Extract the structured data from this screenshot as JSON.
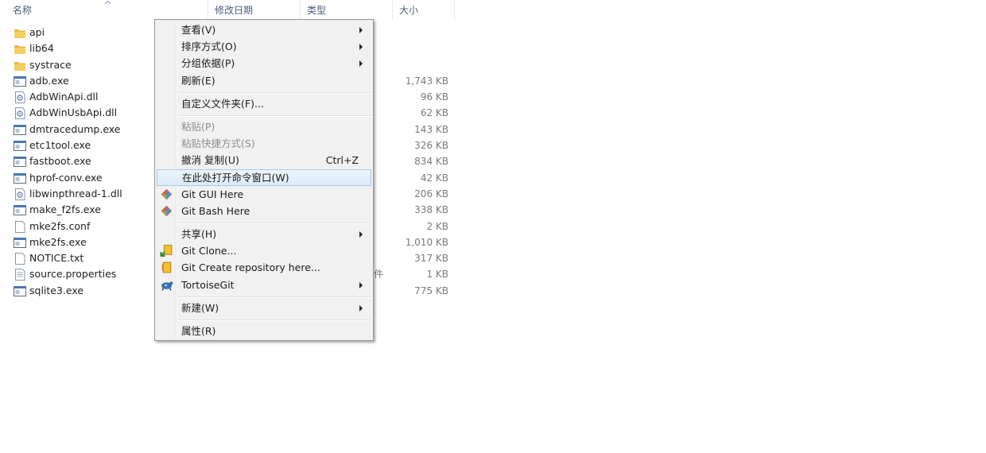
{
  "columns": {
    "name": "名称",
    "date": "修改日期",
    "type": "类型",
    "size": "大小"
  },
  "files": [
    {
      "name": "api",
      "icon": "folder-icon",
      "size": ""
    },
    {
      "name": "lib64",
      "icon": "folder-icon",
      "size": ""
    },
    {
      "name": "systrace",
      "icon": "folder-icon",
      "size": ""
    },
    {
      "name": "adb.exe",
      "icon": "exe-icon",
      "size": "1,743 KB"
    },
    {
      "name": "AdbWinApi.dll",
      "icon": "dll-icon",
      "size": "96 KB"
    },
    {
      "name": "AdbWinUsbApi.dll",
      "icon": "dll-icon",
      "size": "62 KB"
    },
    {
      "name": "dmtracedump.exe",
      "icon": "exe-icon",
      "size": "143 KB"
    },
    {
      "name": "etc1tool.exe",
      "icon": "exe-icon",
      "size": "326 KB"
    },
    {
      "name": "fastboot.exe",
      "icon": "exe-icon",
      "size": "834 KB"
    },
    {
      "name": "hprof-conv.exe",
      "icon": "exe-icon",
      "size": "42 KB"
    },
    {
      "name": "libwinpthread-1.dll",
      "icon": "dll-icon",
      "size": "206 KB"
    },
    {
      "name": "make_f2fs.exe",
      "icon": "exe-icon",
      "size": "338 KB"
    },
    {
      "name": "mke2fs.conf",
      "icon": "blank-file-icon",
      "size": "2 KB"
    },
    {
      "name": "mke2fs.exe",
      "icon": "exe-icon",
      "size": "1,010 KB"
    },
    {
      "name": "NOTICE.txt",
      "icon": "blank-file-icon",
      "size": "317 KB"
    },
    {
      "name": "source.properties",
      "icon": "text-file-icon",
      "size": "1 KB",
      "type_partial": "件"
    },
    {
      "name": "sqlite3.exe",
      "icon": "exe-icon",
      "size": "775 KB"
    }
  ],
  "menu": {
    "view": "查看(V)",
    "sort": "排序方式(O)",
    "group": "分组依据(P)",
    "refresh": "刷新(E)",
    "customize": "自定义文件夹(F)...",
    "paste": "粘贴(P)",
    "paste_shortcut": "粘贴快捷方式(S)",
    "undo_copy": "撤消 复制(U)",
    "undo_shortcut": "Ctrl+Z",
    "open_cmd": "在此处打开命令窗口(W)",
    "git_gui": "Git GUI Here",
    "git_bash": "Git Bash Here",
    "share": "共享(H)",
    "git_clone": "Git Clone...",
    "git_create": "Git Create repository here...",
    "tortoise": "TortoiseGit",
    "new": "新建(W)",
    "properties": "属性(R)"
  },
  "colors": {
    "header_text": "#4c607a",
    "highlight_border": "#a8c8ea",
    "menu_bg": "#f1f1f1",
    "folder": "#e8b94a"
  }
}
